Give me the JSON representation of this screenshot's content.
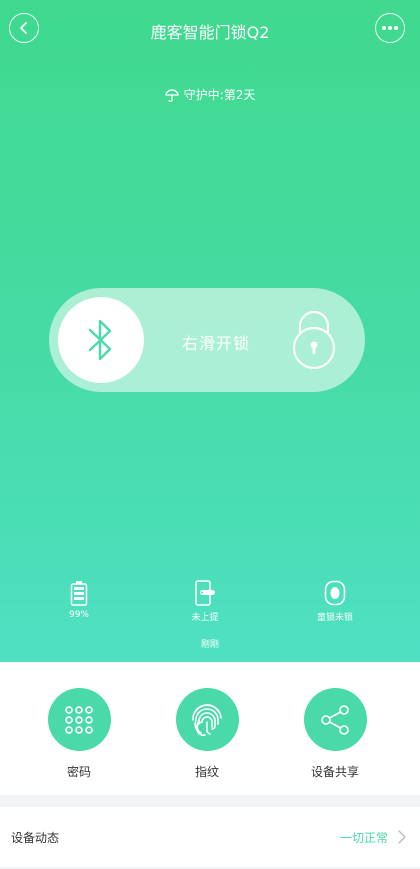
{
  "header": {
    "title": "鹿客智能门锁Q2",
    "status_text": "守护中:第2天"
  },
  "unlock_slider": {
    "label": "右滑开锁"
  },
  "stats": {
    "battery": "99%",
    "handle": "未上提",
    "child_lock": "童锁未锁",
    "updated": "刚刚"
  },
  "actions": [
    {
      "label": "密码"
    },
    {
      "label": "指纹"
    },
    {
      "label": "设备共享"
    }
  ],
  "activity": {
    "label": "设备动态",
    "value": "一切正常"
  },
  "colors": {
    "accent": "#4ad9a9",
    "status_green": "#48d7ae",
    "gradient_top": "#40d98e",
    "gradient_bottom": "#4fe0c3"
  }
}
